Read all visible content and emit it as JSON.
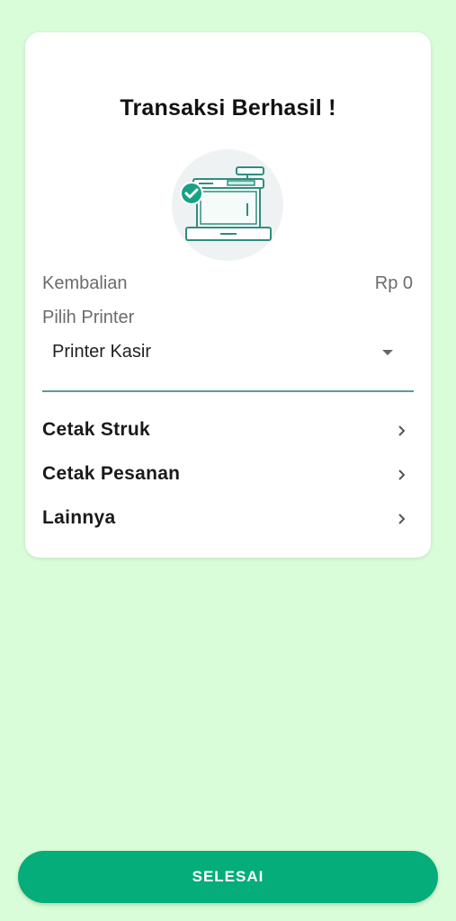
{
  "dialog": {
    "title": "Transaksi Berhasil !",
    "illustration_icon": "cash-register-success-icon",
    "kembalian_label": "Kembalian",
    "kembalian_value": "Rp 0",
    "pilih_printer_label": "Pilih Printer",
    "selected_printer": "Printer Kasir"
  },
  "menu": {
    "items": [
      {
        "label": "Cetak Struk"
      },
      {
        "label": "Cetak Pesanan"
      },
      {
        "label": "Lainnya"
      }
    ]
  },
  "footer": {
    "selesai_label": "SELESAI"
  },
  "colors": {
    "background": "#d8fdd8",
    "accent": "#04ad7a",
    "underline": "#5e9a93"
  }
}
